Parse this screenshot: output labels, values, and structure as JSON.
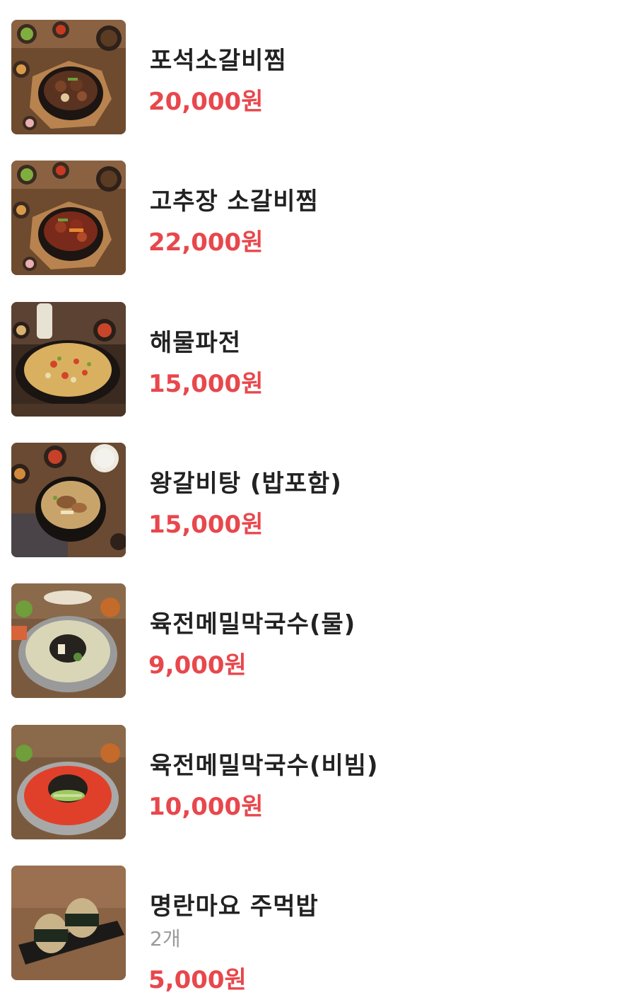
{
  "menu": {
    "items": [
      {
        "name": "포석소갈비찜",
        "price": "20,000원",
        "image": "braised-short-ribs-photo"
      },
      {
        "name": "고추장 소갈비찜",
        "price": "22,000원",
        "image": "gochujang-short-ribs-photo"
      },
      {
        "name": "해물파전",
        "price": "15,000원",
        "image": "seafood-pancake-photo"
      },
      {
        "name": "왕갈비탕 (밥포함)",
        "price": "15,000원",
        "image": "galbitang-photo"
      },
      {
        "name": "육전메밀막국수(물)",
        "price": "9,000원",
        "image": "cold-buckwheat-noodle-photo"
      },
      {
        "name": "육전메밀막국수(비빔)",
        "price": "10,000원",
        "image": "spicy-buckwheat-noodle-photo"
      },
      {
        "name": "명란마요 주먹밥",
        "description": "2개",
        "price": "5,000원",
        "image": "rice-ball-photo"
      }
    ]
  },
  "colors": {
    "price": "#e8474c",
    "name": "#222222",
    "description": "#9a9a9a"
  }
}
